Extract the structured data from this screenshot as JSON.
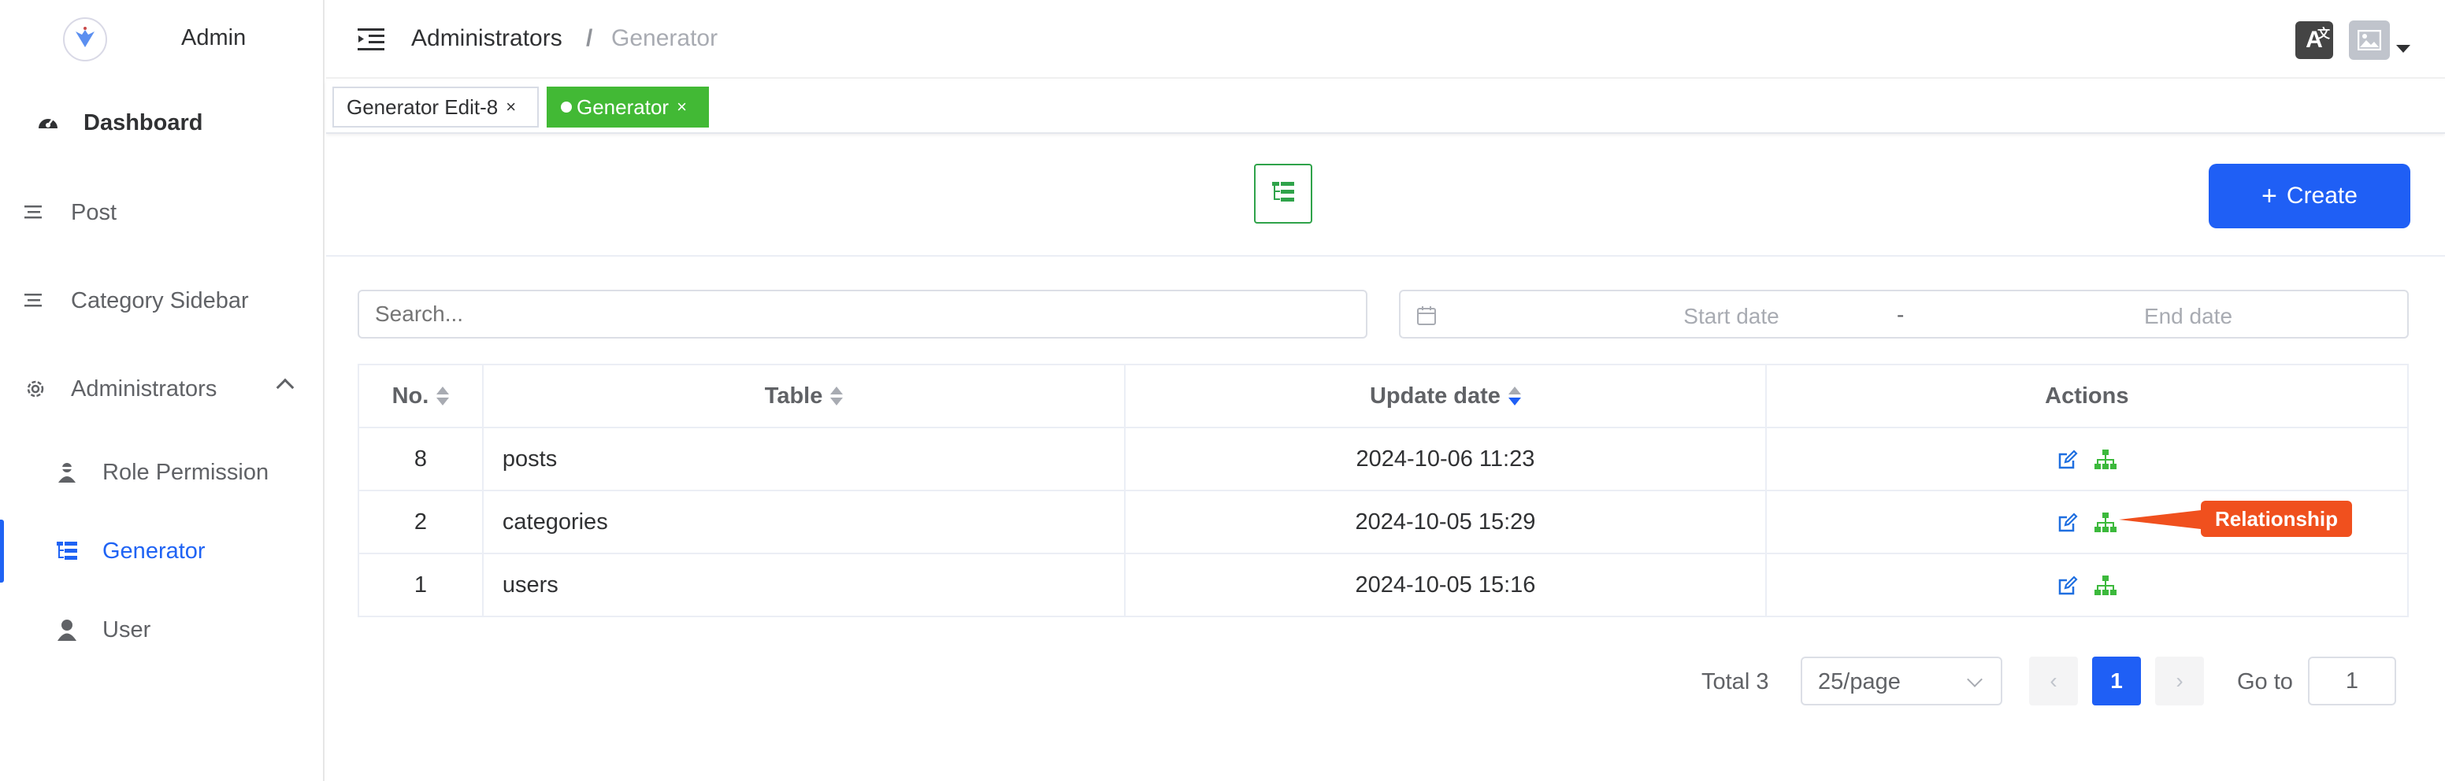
{
  "app": {
    "name": "Admin"
  },
  "sidebar": {
    "items": [
      {
        "label": "Dashboard",
        "icon": "dashboard-icon"
      },
      {
        "label": "Post",
        "icon": "list-icon"
      },
      {
        "label": "Category Sidebar",
        "icon": "list-icon"
      },
      {
        "label": "Administrators",
        "icon": "gear-icon",
        "expanded": true
      },
      {
        "label": "Role Permission",
        "icon": "user-secret-icon"
      },
      {
        "label": "Generator",
        "icon": "tree-list-icon",
        "active": true
      },
      {
        "label": "User",
        "icon": "user-icon"
      }
    ]
  },
  "header": {
    "breadcrumb": [
      "Administrators",
      "/",
      "Generator"
    ]
  },
  "tags": [
    {
      "label": "Generator Edit-8",
      "close": "×"
    },
    {
      "label": "Generator",
      "close": "×",
      "active": true
    }
  ],
  "toolbar": {
    "create_label": "Create",
    "create_icon": "+"
  },
  "filters": {
    "search_placeholder": "Search...",
    "start_placeholder": "Start date",
    "range_separator": "-",
    "end_placeholder": "End date"
  },
  "table": {
    "columns": [
      "No.",
      "Table",
      "Update date",
      "Actions"
    ],
    "rows": [
      {
        "no": "8",
        "table": "posts",
        "updated": "2024-10-06 11:23"
      },
      {
        "no": "2",
        "table": "categories",
        "updated": "2024-10-05 15:29"
      },
      {
        "no": "1",
        "table": "users",
        "updated": "2024-10-05 15:16"
      }
    ]
  },
  "tooltip": {
    "text": "Relationship"
  },
  "pagination": {
    "total_text": "Total 3",
    "page_size": "25/page",
    "current_page": "1",
    "prev": "‹",
    "next": "›",
    "goto_label": "Go to",
    "goto_value": "1"
  },
  "colors": {
    "primary": "#1f5ff5",
    "success": "#42b935",
    "tooltip": "#f0501e",
    "edit_icon": "#1f6fe0",
    "tree_icon": "#3cb93c"
  }
}
